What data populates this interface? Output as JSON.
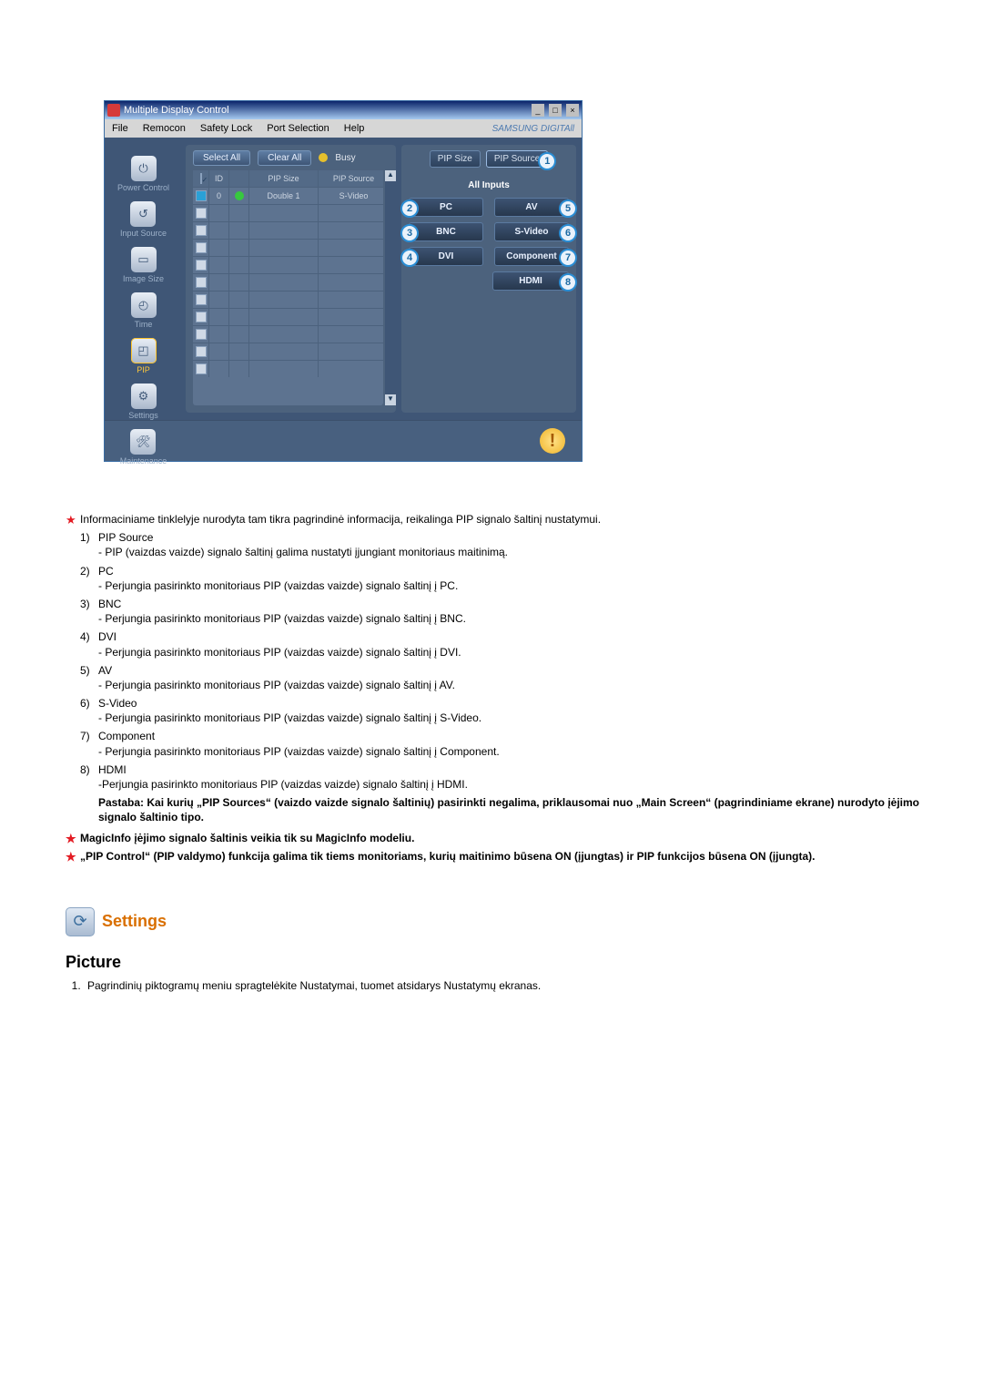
{
  "app": {
    "title": "Multiple Display Control",
    "win_btns": [
      "_",
      "□",
      "×"
    ],
    "brand": "SAMSUNG DIGITAll"
  },
  "menu": {
    "file": "File",
    "remocon": "Remocon",
    "safety": "Safety Lock",
    "port": "Port Selection",
    "help": "Help"
  },
  "sidebar": {
    "items": [
      {
        "icon": "⏻",
        "label": "Power Control"
      },
      {
        "icon": "↺",
        "label": "Input Source"
      },
      {
        "icon": "▭",
        "label": "Image Size"
      },
      {
        "icon": "◴",
        "label": "Time"
      },
      {
        "icon": "◰",
        "label": "PIP"
      },
      {
        "icon": "⚙",
        "label": "Settings"
      },
      {
        "icon": "🛠",
        "label": "Maintenance"
      }
    ]
  },
  "toolbar": {
    "select_all": "Select All",
    "clear_all": "Clear All",
    "busy": "Busy"
  },
  "grid": {
    "cols": {
      "id": "ID",
      "c1": "",
      "c2": "",
      "size": "PIP Size",
      "source": "PIP Source"
    },
    "row": {
      "id": "0",
      "size": "Double 1",
      "source": "S-Video"
    }
  },
  "right": {
    "pip_size": "PIP Size",
    "pip_source": "PIP Source",
    "all_inputs": "All Inputs",
    "inputs": {
      "pc": "PC",
      "av": "AV",
      "bnc": "BNC",
      "svideo": "S-Video",
      "dvi": "DVI",
      "component": "Component",
      "hdmi": "HDMI"
    },
    "badges": {
      "b1": "1",
      "b2": "2",
      "b3": "3",
      "b4": "4",
      "b5": "5",
      "b6": "6",
      "b7": "7",
      "b8": "8"
    }
  },
  "text": {
    "intro": "Informaciniame tinklelyje nurodyta tam tikra pagrindinė informacija, reikalinga PIP signalo šaltinį nustatymui.",
    "items": [
      {
        "n": "1)",
        "t": "PIP Source",
        "d": "- PIP (vaizdas vaizde) signalo šaltinį galima nustatyti įjungiant monitoriaus maitinimą."
      },
      {
        "n": "2)",
        "t": "PC",
        "d": "- Perjungia pasirinkto monitoriaus PIP (vaizdas vaizde) signalo šaltinį į PC."
      },
      {
        "n": "3)",
        "t": "BNC",
        "d": "- Perjungia pasirinkto monitoriaus PIP (vaizdas vaizde) signalo šaltinį į BNC."
      },
      {
        "n": "4)",
        "t": "DVI",
        "d": "- Perjungia pasirinkto monitoriaus PIP (vaizdas vaizde) signalo šaltinį į DVI."
      },
      {
        "n": "5)",
        "t": "AV",
        "d": "- Perjungia pasirinkto monitoriaus PIP (vaizdas vaizde) signalo šaltinį į AV."
      },
      {
        "n": "6)",
        "t": "S-Video",
        "d": "- Perjungia pasirinkto monitoriaus PIP (vaizdas vaizde) signalo šaltinį į S-Video."
      },
      {
        "n": "7)",
        "t": "Component",
        "d": "- Perjungia pasirinkto monitoriaus PIP (vaizdas vaizde) signalo šaltinį į Component."
      },
      {
        "n": "8)",
        "t": "HDMI",
        "d": "-Perjungia pasirinkto monitoriaus PIP (vaizdas vaizde) signalo šaltinį į HDMI."
      }
    ],
    "note": "Pastaba: Kai kurių „PIP Sources“ (vaizdo vaizde signalo šaltinių) pasirinkti negalima, priklausomai nuo „Main Screen“ (pagrindiniame ekrane) nurodyto įėjimo signalo šaltinio tipo.",
    "star2": "MagicInfo įėjimo signalo šaltinis veikia tik su MagicInfo modeliu.",
    "star3": "„PIP Control“ (PIP valdymo) funkcija galima tik tiems monitoriams, kurių maitinimo būsena ON (įjungtas) ir PIP funkcijos būsena ON (įjungta)."
  },
  "settings": {
    "title": "Settings",
    "icon": "⟳"
  },
  "picture": {
    "heading": "Picture",
    "li1": "Pagrindinių piktogramų meniu spragtelėkite Nustatymai, tuomet atsidarys Nustatymų ekranas."
  }
}
